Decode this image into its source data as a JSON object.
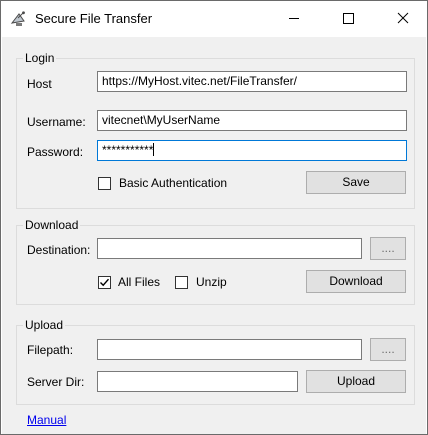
{
  "window": {
    "title": "Secure File Transfer",
    "icon": "satellite-dish-icon",
    "controls": {
      "minimize": "minimize-icon",
      "maximize": "maximize-icon",
      "close": "close-icon"
    }
  },
  "login": {
    "legend": "Login",
    "host_label": "Host",
    "host_value": "https://MyHost.vitec.net/FileTransfer/",
    "username_label": "Username:",
    "username_value": "vitecnet\\MyUserName",
    "password_label": "Password:",
    "password_value": "***********",
    "basic_auth_label": "Basic Authentication",
    "basic_auth_checked": false,
    "save_label": "Save"
  },
  "download": {
    "legend": "Download",
    "destination_label": "Destination:",
    "destination_value": "",
    "browse_label": "....",
    "all_files_label": "All Files",
    "all_files_checked": true,
    "unzip_label": "Unzip",
    "unzip_checked": false,
    "download_label": "Download"
  },
  "upload": {
    "legend": "Upload",
    "filepath_label": "Filepath:",
    "filepath_value": "",
    "browse_label": "....",
    "server_dir_label": "Server Dir:",
    "server_dir_value": "",
    "upload_label": "Upload"
  },
  "footer": {
    "manual_link": "Manual"
  }
}
